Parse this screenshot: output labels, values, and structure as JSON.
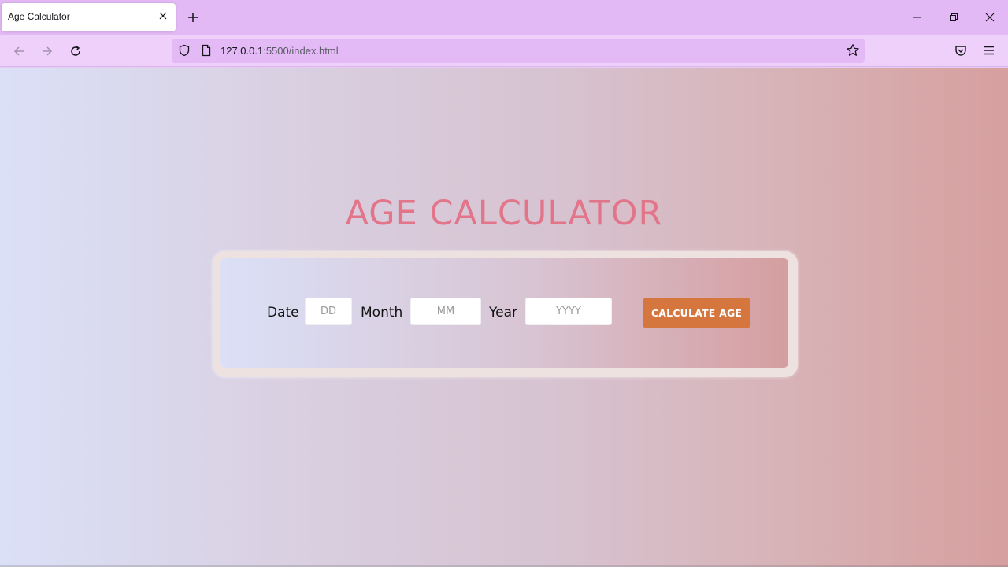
{
  "browser": {
    "tab_title": "Age Calculator",
    "url_host": "127.0.0.1",
    "url_path": ":5500/index.html"
  },
  "page": {
    "title": "AGE CALCULATOR",
    "date_label": "Date",
    "date_placeholder": "DD",
    "month_label": "Month",
    "month_placeholder": "MM",
    "year_label": "Year",
    "year_placeholder": "YYYY",
    "calculate_label": "CALCULATE AGE"
  },
  "colors": {
    "title": "#e2758a",
    "button": "#d5763f",
    "chrome": "#e3b9f5"
  }
}
